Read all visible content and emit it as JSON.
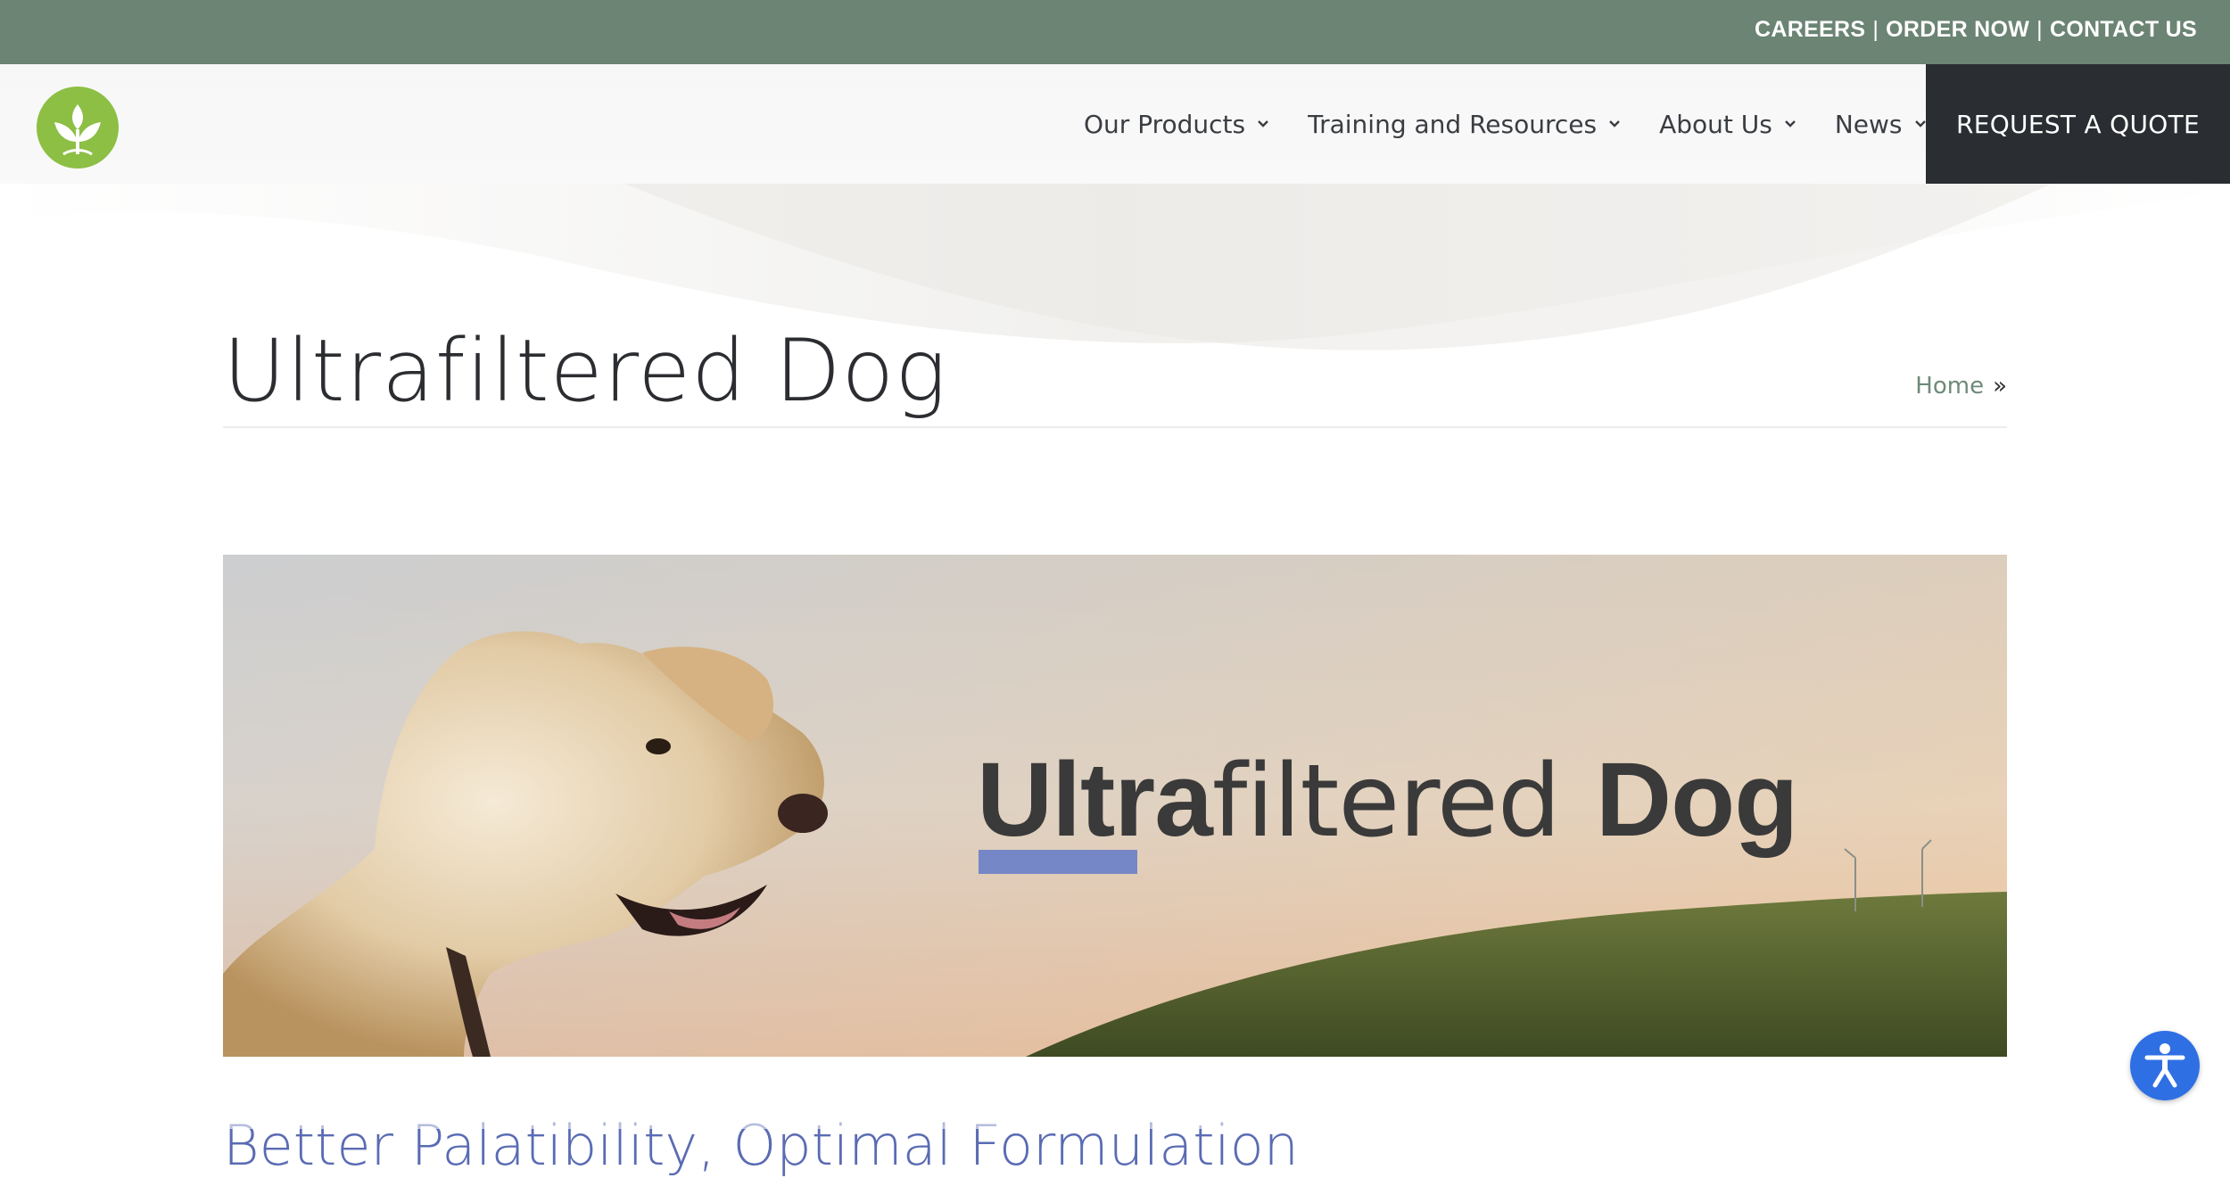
{
  "topbar": {
    "links": [
      "CAREERS",
      "ORDER NOW",
      "CONTACT US"
    ],
    "separator": "|"
  },
  "header": {
    "logo_icon": "leaf-sprout-logo",
    "nav": [
      {
        "label": "Our Products"
      },
      {
        "label": "Training and Resources"
      },
      {
        "label": "About Us"
      },
      {
        "label": "News"
      }
    ],
    "quote_button": "REQUEST A QUOTE"
  },
  "page": {
    "title": "Ultrafiltered Dog",
    "breadcrumb": {
      "home": "Home",
      "separator": "»"
    }
  },
  "hero": {
    "brand_bold": "Ultra",
    "brand_light": "filtered",
    "brand_dog": "Dog",
    "description": "golden retriever in front of a sunset hillside"
  },
  "section": {
    "heading": "Better Palatibility, Optimal Formulation"
  },
  "accessibility": {
    "icon": "accessibility-person-icon"
  },
  "colors": {
    "topbar": "#6b8473",
    "logo": "#8cbf44",
    "quote_bg": "#2a2d31",
    "accent_underline": "#7587c6",
    "a11y": "#2f6fe4"
  }
}
